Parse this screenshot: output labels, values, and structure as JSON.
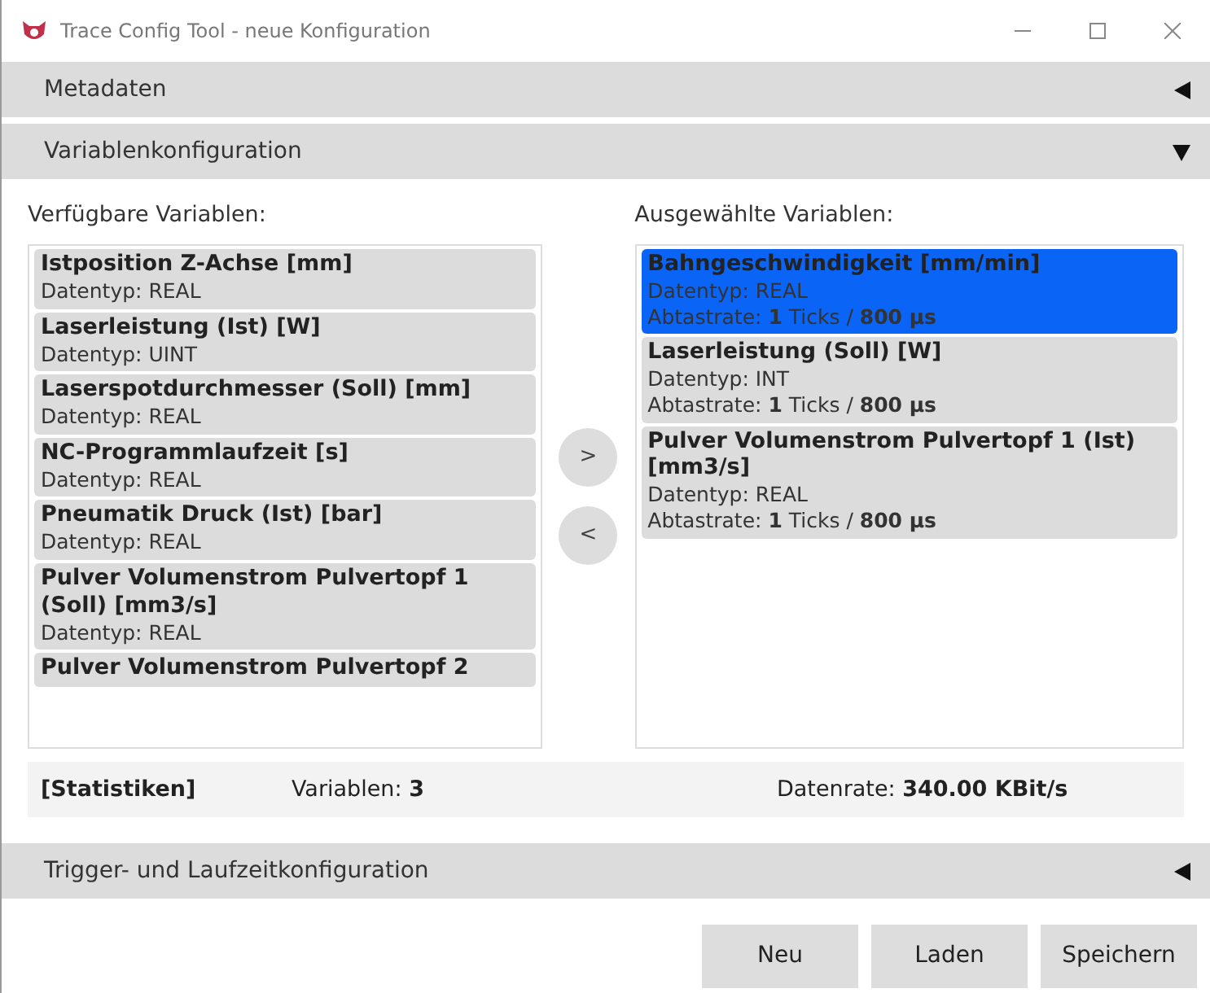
{
  "window": {
    "title": "Trace Config Tool - neue Konfiguration"
  },
  "sections": [
    {
      "title": "Metadaten",
      "expanded": false
    },
    {
      "title": "Variablenkonfiguration",
      "expanded": true
    }
  ],
  "available": {
    "label": "Verfügbare Variablen:",
    "items": [
      {
        "name": "Istposition Z-Achse [mm]",
        "datatype": "Datentyp: REAL"
      },
      {
        "name": "Laserleistung (Ist) [W]",
        "datatype": "Datentyp: UINT"
      },
      {
        "name": "Laserspotdurchmesser (Soll) [mm]",
        "datatype": "Datentyp: REAL"
      },
      {
        "name": "NC-Programmlaufzeit [s]",
        "datatype": "Datentyp: REAL"
      },
      {
        "name": "Pneumatik Druck (Ist) [bar]",
        "datatype": "Datentyp: REAL"
      },
      {
        "name": "Pulver Volumenstrom Pulvertopf 1 (Soll) [mm3/s]",
        "datatype": "Datentyp: REAL"
      },
      {
        "name": "Pulver Volumenstrom Pulvertopf 2"
      }
    ]
  },
  "move_buttons": [
    ">",
    "<"
  ],
  "selected_list": {
    "label": "Ausgewählte Variablen:",
    "items": [
      {
        "name": "Bahngeschwindigkeit [mm/min]",
        "datatype": "Datentyp: REAL",
        "rate": "Abtastrate: **1** Ticks / **800 µs**",
        "selected": true
      },
      {
        "name": "Laserleistung (Soll) [W]",
        "datatype": "Datentyp: INT",
        "rate": "Abtastrate: **1** Ticks / **800 µs**",
        "selected": false
      },
      {
        "name": "Pulver Volumenstrom Pulvertopf 1 (Ist) [mm3/s]",
        "datatype": "Datentyp: REAL",
        "rate": "Abtastrate: **1** Ticks / **800 µs**",
        "selected": false
      }
    ]
  },
  "statistics": {
    "title": "[Statistiken]",
    "variables": "Variablen: **3**",
    "datarate": "Datenrate: **340.00 KBit/s**"
  },
  "trigger_section": {
    "title": "Trigger- und Laufzeitkonfiguration",
    "expanded": false
  },
  "buttons": [
    "Neu",
    "Laden",
    "Speichern"
  ]
}
